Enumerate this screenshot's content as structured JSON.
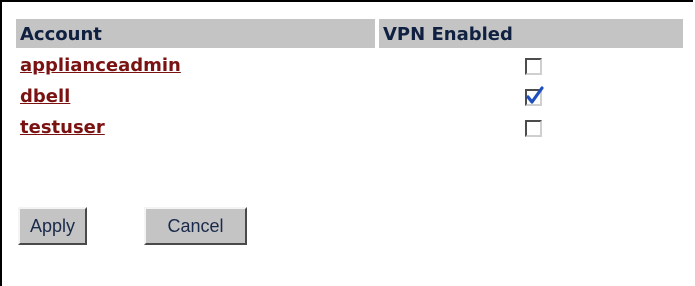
{
  "table": {
    "headers": {
      "account": "Account",
      "vpn_enabled": "VPN Enabled"
    },
    "rows": [
      {
        "account": "applianceadmin",
        "vpn_enabled": false
      },
      {
        "account": "dbell",
        "vpn_enabled": true
      },
      {
        "account": "testuser",
        "vpn_enabled": false
      }
    ]
  },
  "buttons": {
    "apply_label": "Apply",
    "cancel_label": "Cancel"
  },
  "colors": {
    "header_background": "#c4c4c4",
    "link_color": "#7a1212",
    "checkmark_color": "#1f4fbf"
  }
}
